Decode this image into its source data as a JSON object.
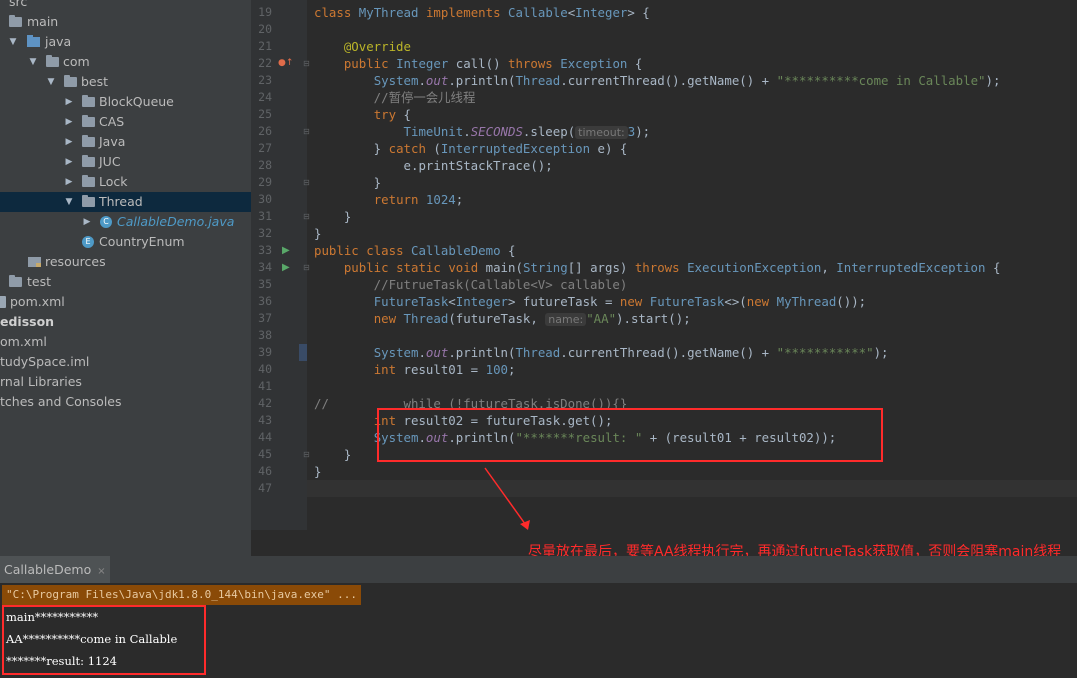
{
  "project_tree": [
    {
      "label": "src",
      "type": "folder",
      "expanded": true
    },
    {
      "label": "main",
      "type": "folder",
      "expanded": true
    },
    {
      "label": "java",
      "type": "source-folder",
      "expanded": true
    },
    {
      "label": "com",
      "type": "package",
      "expanded": true
    },
    {
      "label": "best",
      "type": "package",
      "expanded": true
    },
    {
      "label": "BlockQueue",
      "type": "package",
      "expanded": false
    },
    {
      "label": "CAS",
      "type": "package",
      "expanded": false
    },
    {
      "label": "Java",
      "type": "package",
      "expanded": false
    },
    {
      "label": "JUC",
      "type": "package",
      "expanded": false
    },
    {
      "label": "Lock",
      "type": "package",
      "expanded": false
    },
    {
      "label": "Thread",
      "type": "package",
      "expanded": true,
      "selected": true
    },
    {
      "label": "CallableDemo.java",
      "type": "class-file",
      "expanded": false
    },
    {
      "label": "CountryEnum",
      "type": "enum"
    },
    {
      "label": "resources",
      "type": "resources-folder"
    },
    {
      "label": "test",
      "type": "folder"
    },
    {
      "label": "pom.xml",
      "type": "file"
    },
    {
      "label": "edisson",
      "type": "module"
    },
    {
      "label": "om.xml",
      "type": "file"
    },
    {
      "label": "tudySpace.iml",
      "type": "file"
    },
    {
      "label": "rnal Libraries",
      "type": "libraries"
    },
    {
      "label": "tches and Consoles",
      "type": "scratches"
    }
  ],
  "editor": {
    "lines": [
      {
        "num": "19",
        "code": "class MyThread implements Callable<Integer> {"
      },
      {
        "num": "20",
        "code": ""
      },
      {
        "num": "21",
        "code": "    @Override"
      },
      {
        "num": "22",
        "code": "    public Integer call() throws Exception {"
      },
      {
        "num": "23",
        "code": "        System.out.println(Thread.currentThread().getName() + \"**********come in Callable\");"
      },
      {
        "num": "24",
        "code": "        //暂停一会儿线程"
      },
      {
        "num": "25",
        "code": "        try {"
      },
      {
        "num": "26",
        "code": "            TimeUnit.SECONDS.sleep("
      },
      {
        "num": "27",
        "code": "        } catch (InterruptedException e) {"
      },
      {
        "num": "28",
        "code": "            e.printStackTrace();"
      },
      {
        "num": "29",
        "code": "        }"
      },
      {
        "num": "30",
        "code": "        return 1024;"
      },
      {
        "num": "31",
        "code": "    }"
      },
      {
        "num": "32",
        "code": "}"
      },
      {
        "num": "33",
        "code": "public class CallableDemo {"
      },
      {
        "num": "34",
        "code": "    public static void main(String[] args) throws ExecutionException, InterruptedException {"
      },
      {
        "num": "35",
        "code": "        //FutrueTask(Callable<V> callable)"
      },
      {
        "num": "36",
        "code": "        FutureTask<Integer> futureTask = new FutureTask<>(new MyThread());"
      },
      {
        "num": "37",
        "code": "        new Thread(futureTask, "
      },
      {
        "num": "38",
        "code": ""
      },
      {
        "num": "39",
        "code": "        System.out.println(Thread.currentThread().getName() + \"***********\");"
      },
      {
        "num": "40",
        "code": "        int result01 = 100;"
      },
      {
        "num": "41",
        "code": ""
      },
      {
        "num": "42",
        "code": "//          while (!futureTask.isDone()){}"
      },
      {
        "num": "43",
        "code": "        int result02 = futureTask.get();"
      },
      {
        "num": "44",
        "code": "        System.out.println(\"*******result: \" + (result01 + result02));"
      },
      {
        "num": "45",
        "code": "    }"
      },
      {
        "num": "46",
        "code": "}"
      },
      {
        "num": "47",
        "code": ""
      }
    ],
    "line26_param_hint": "timeout:",
    "line26_tail": "3);",
    "line37_param_hint": "name:",
    "line37_tail": "\"AA\").start();",
    "current_line": "47"
  },
  "annotation_text": "尽量放在最后，要等AA线程执行完，再通过futrueTask获取值，否则会阻塞main线程",
  "run_panel": {
    "tab_label": "CallableDemo",
    "tab_close": "×",
    "command_line": "\"C:\\Program Files\\Java\\jdk1.8.0_144\\bin\\java.exe\" ...",
    "output": [
      "main***********",
      "AA**********come in Callable",
      "*******result: 1124"
    ]
  },
  "colors": {
    "keyword": "#cc7832",
    "annotation": "#bbb529",
    "string": "#6a8759",
    "number": "#6897bb",
    "comment": "#808080",
    "class_ref": "#a9b7c6",
    "type": "#9876aa",
    "highlight_box": "#ff2b2b"
  }
}
